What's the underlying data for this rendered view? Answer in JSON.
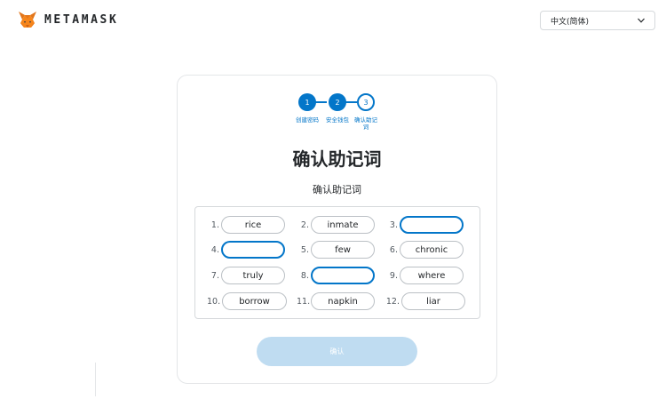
{
  "header": {
    "brand_name": "METAMASK",
    "language_selected": "中文(简体)"
  },
  "progress": {
    "steps": [
      {
        "number": "1",
        "label": "创建密码",
        "state": "done"
      },
      {
        "number": "2",
        "label": "安全钱包",
        "state": "done"
      },
      {
        "number": "3",
        "label": "确认助记词",
        "state": "current"
      }
    ]
  },
  "main": {
    "title": "确认助记词",
    "subtitle": "确认助记词",
    "words": [
      {
        "index": "1.",
        "word": "rice",
        "blank": false
      },
      {
        "index": "2.",
        "word": "inmate",
        "blank": false
      },
      {
        "index": "3.",
        "word": "",
        "blank": true
      },
      {
        "index": "4.",
        "word": "",
        "blank": true
      },
      {
        "index": "5.",
        "word": "few",
        "blank": false
      },
      {
        "index": "6.",
        "word": "chronic",
        "blank": false
      },
      {
        "index": "7.",
        "word": "truly",
        "blank": false
      },
      {
        "index": "8.",
        "word": "",
        "blank": true
      },
      {
        "index": "9.",
        "word": "where",
        "blank": false
      },
      {
        "index": "10.",
        "word": "borrow",
        "blank": false
      },
      {
        "index": "11.",
        "word": "napkin",
        "blank": false
      },
      {
        "index": "12.",
        "word": "liar",
        "blank": false
      }
    ],
    "confirm_label": "确认"
  },
  "colors": {
    "accent": "#0376c9",
    "confirm_disabled_bg": "#bfdcf1",
    "border": "#d6d9dc"
  },
  "icons": {
    "logo": "metamask-fox-icon",
    "dropdown": "chevron-down-icon"
  }
}
